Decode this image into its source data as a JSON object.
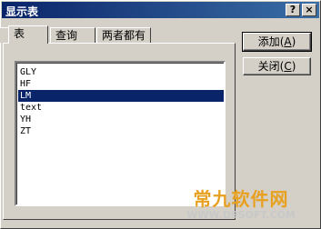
{
  "window": {
    "title": "显示表",
    "help_glyph": "?",
    "close_glyph": "×"
  },
  "tabs": [
    {
      "label": "表",
      "selected": true
    },
    {
      "label": "查询",
      "selected": false
    },
    {
      "label": "两者都有",
      "selected": false
    }
  ],
  "tables": [
    {
      "name": "GLY",
      "selected": false
    },
    {
      "name": "HF",
      "selected": false
    },
    {
      "name": "LM",
      "selected": true
    },
    {
      "name": "text",
      "selected": false
    },
    {
      "name": "YH",
      "selected": false
    },
    {
      "name": "ZT",
      "selected": false
    }
  ],
  "buttons": {
    "add": {
      "label": "添加",
      "hotkey": "A"
    },
    "close": {
      "label": "关闭",
      "hotkey": "C"
    }
  },
  "watermark": {
    "text": "常九软件网",
    "url": "WWW.D9SOFT.COM"
  },
  "colors": {
    "face": "#d4d0c8",
    "title_start": "#0a246a",
    "title_end": "#3a6ea5",
    "selection": "#0a246a",
    "watermark": "#e8a020"
  }
}
